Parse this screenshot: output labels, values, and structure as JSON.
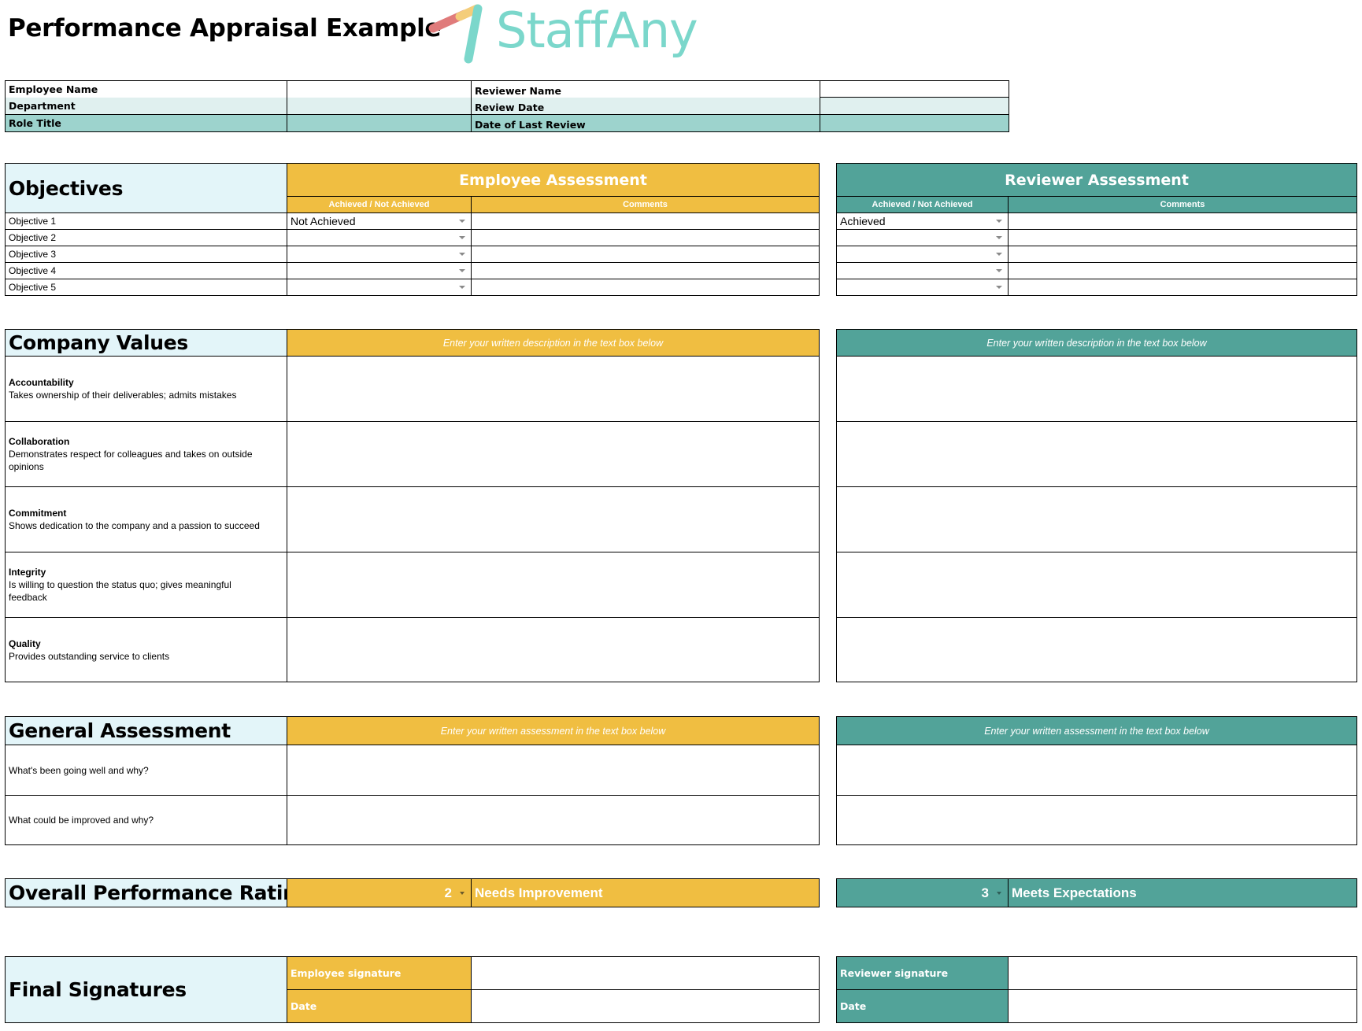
{
  "header": {
    "title": "Performance Appraisal Example",
    "logo_text": "StaffAny",
    "logo_icon": "staffany-logo-icon"
  },
  "colors": {
    "employee_accent": "#f0be41",
    "reviewer_accent": "#52a399",
    "section_label_bg": "#e3f5f9",
    "logo_teal": "#7bd7cb",
    "logo_red": "#e07b7b",
    "logo_yellow": "#f4cd7a"
  },
  "info": {
    "rows": [
      {
        "label": "Employee Name",
        "value": "",
        "right_label": "Reviewer Name",
        "right_value": ""
      },
      {
        "label": "Department",
        "value": "",
        "right_label": "Review Date",
        "right_value": ""
      },
      {
        "label": "Role Title",
        "value": "",
        "right_label": "Date of Last Review",
        "right_value": ""
      }
    ]
  },
  "objectives": {
    "title": "Objectives",
    "employee_header": "Employee Assessment",
    "reviewer_header": "Reviewer Assessment",
    "status_col": "Achieved / Not Achieved",
    "comments_col": "Comments",
    "rows": [
      {
        "label": "Objective 1",
        "employee_status": "Not Achieved",
        "employee_comment": "",
        "reviewer_status": "Achieved",
        "reviewer_comment": ""
      },
      {
        "label": "Objective 2",
        "employee_status": "",
        "employee_comment": "",
        "reviewer_status": "",
        "reviewer_comment": ""
      },
      {
        "label": "Objective 3",
        "employee_status": "",
        "employee_comment": "",
        "reviewer_status": "",
        "reviewer_comment": ""
      },
      {
        "label": "Objective 4",
        "employee_status": "",
        "employee_comment": "",
        "reviewer_status": "",
        "reviewer_comment": ""
      },
      {
        "label": "Objective 5",
        "employee_status": "",
        "employee_comment": "",
        "reviewer_status": "",
        "reviewer_comment": ""
      }
    ]
  },
  "company_values": {
    "title": "Company Values",
    "employee_hint": "Enter your written description in the text box below",
    "reviewer_hint": "Enter your written description in the text box below",
    "rows": [
      {
        "name": "Accountability",
        "description": "Takes ownership of their deliverables; admits mistakes"
      },
      {
        "name": "Collaboration",
        "description": "Demonstrates respect for colleagues and takes on outside opinions"
      },
      {
        "name": "Commitment",
        "description": "Shows dedication to the company and a passion to succeed"
      },
      {
        "name": "Integrity",
        "description": "Is willing to question the status quo; gives meaningful feedback"
      },
      {
        "name": "Quality",
        "description": "Provides outstanding service to clients"
      }
    ]
  },
  "general_assessment": {
    "title": "General Assessment",
    "employee_hint": "Enter your written assessment in the text box below",
    "reviewer_hint": "Enter your written assessment in the text box below",
    "rows": [
      {
        "question": "What's been going well and why?"
      },
      {
        "question": "What could be improved and why?"
      }
    ]
  },
  "overall_rating": {
    "title": "Overall Performance Rating",
    "employee_score": "2",
    "employee_label": "Needs Improvement",
    "reviewer_score": "3",
    "reviewer_label": "Meets Expectations"
  },
  "signatures": {
    "title": "Final Signatures",
    "employee_signature_label": "Employee signature",
    "employee_date_label": "Date",
    "reviewer_signature_label": "Reviewer signature",
    "reviewer_date_label": "Date"
  }
}
